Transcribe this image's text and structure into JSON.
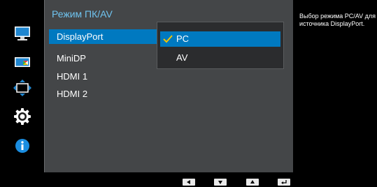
{
  "menu": {
    "title": "Режим ПК/AV",
    "items": [
      {
        "label": "DisplayPort",
        "selected": true
      },
      {
        "label": "MiniDP",
        "selected": false
      },
      {
        "label": "HDMI 1",
        "selected": false
      },
      {
        "label": "HDMI 2",
        "selected": false
      }
    ]
  },
  "submenu": {
    "options": [
      {
        "label": "PC",
        "selected": true
      },
      {
        "label": "AV",
        "selected": false
      }
    ]
  },
  "help": {
    "text": "Выбор режима PC/AV для источника DisplayPort."
  },
  "sidebar_icons": [
    "monitor-icon",
    "color-icon",
    "size-position-icon",
    "settings-gear-icon",
    "info-icon"
  ],
  "nav_buttons": [
    "left-arrow-icon",
    "down-arrow-icon",
    "up-arrow-icon",
    "enter-icon"
  ],
  "colors": {
    "accent": "#0079c0",
    "title": "#6fc4f0",
    "panel": "#444648",
    "info": "#1a8de0"
  }
}
